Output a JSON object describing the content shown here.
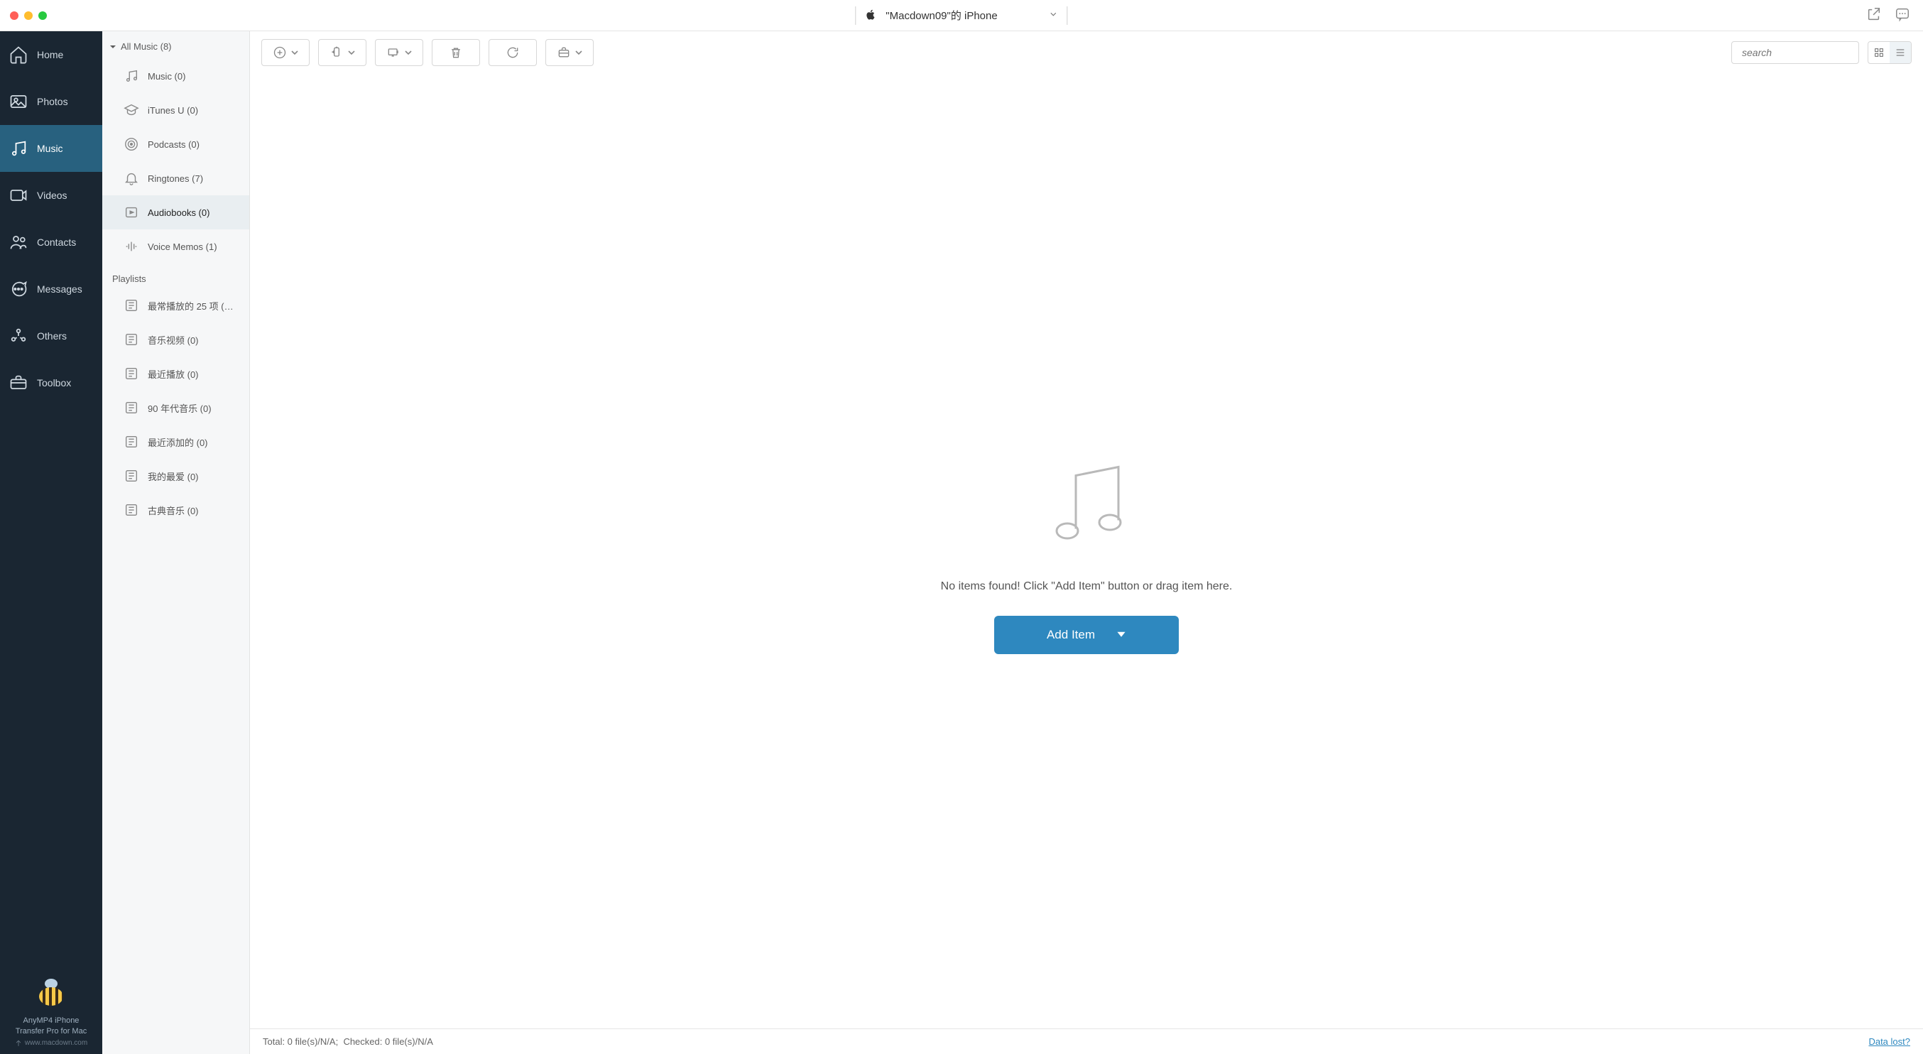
{
  "titlebar": {
    "device_name": "\"Macdown09\"的 iPhone"
  },
  "leftnav": {
    "items": [
      {
        "key": "home",
        "label": "Home"
      },
      {
        "key": "photos",
        "label": "Photos"
      },
      {
        "key": "music",
        "label": "Music"
      },
      {
        "key": "videos",
        "label": "Videos"
      },
      {
        "key": "contacts",
        "label": "Contacts"
      },
      {
        "key": "messages",
        "label": "Messages"
      },
      {
        "key": "others",
        "label": "Others"
      },
      {
        "key": "toolbox",
        "label": "Toolbox"
      }
    ],
    "active": "music"
  },
  "brand": {
    "line1": "AnyMP4 iPhone",
    "line2": "Transfer Pro for Mac",
    "url": "www.macdown.com"
  },
  "midcol": {
    "all_music_label": "All Music (8)",
    "categories": [
      {
        "key": "music",
        "label": "Music (0)"
      },
      {
        "key": "itunesu",
        "label": "iTunes U (0)"
      },
      {
        "key": "podcasts",
        "label": "Podcasts (0)"
      },
      {
        "key": "ringtones",
        "label": "Ringtones (7)"
      },
      {
        "key": "audiobooks",
        "label": "Audiobooks (0)"
      },
      {
        "key": "voicememos",
        "label": "Voice Memos (1)"
      }
    ],
    "selected": "audiobooks",
    "playlists_label": "Playlists",
    "playlists": [
      {
        "label": "最常播放的 25 项 (…"
      },
      {
        "label": "音乐视频 (0)"
      },
      {
        "label": "最近播放 (0)"
      },
      {
        "label": "90 年代音乐 (0)"
      },
      {
        "label": "最近添加的 (0)"
      },
      {
        "label": "我的最爱 (0)"
      },
      {
        "label": "古典音乐 (0)"
      }
    ]
  },
  "toolbar": {
    "search_placeholder": "search"
  },
  "empty": {
    "message": "No items found! Click \"Add Item\" button or drag item here.",
    "add_item_label": "Add Item"
  },
  "statusbar": {
    "total": "Total: 0 file(s)/N/A;",
    "checked": "Checked: 0 file(s)/N/A",
    "data_lost": "Data lost?"
  }
}
